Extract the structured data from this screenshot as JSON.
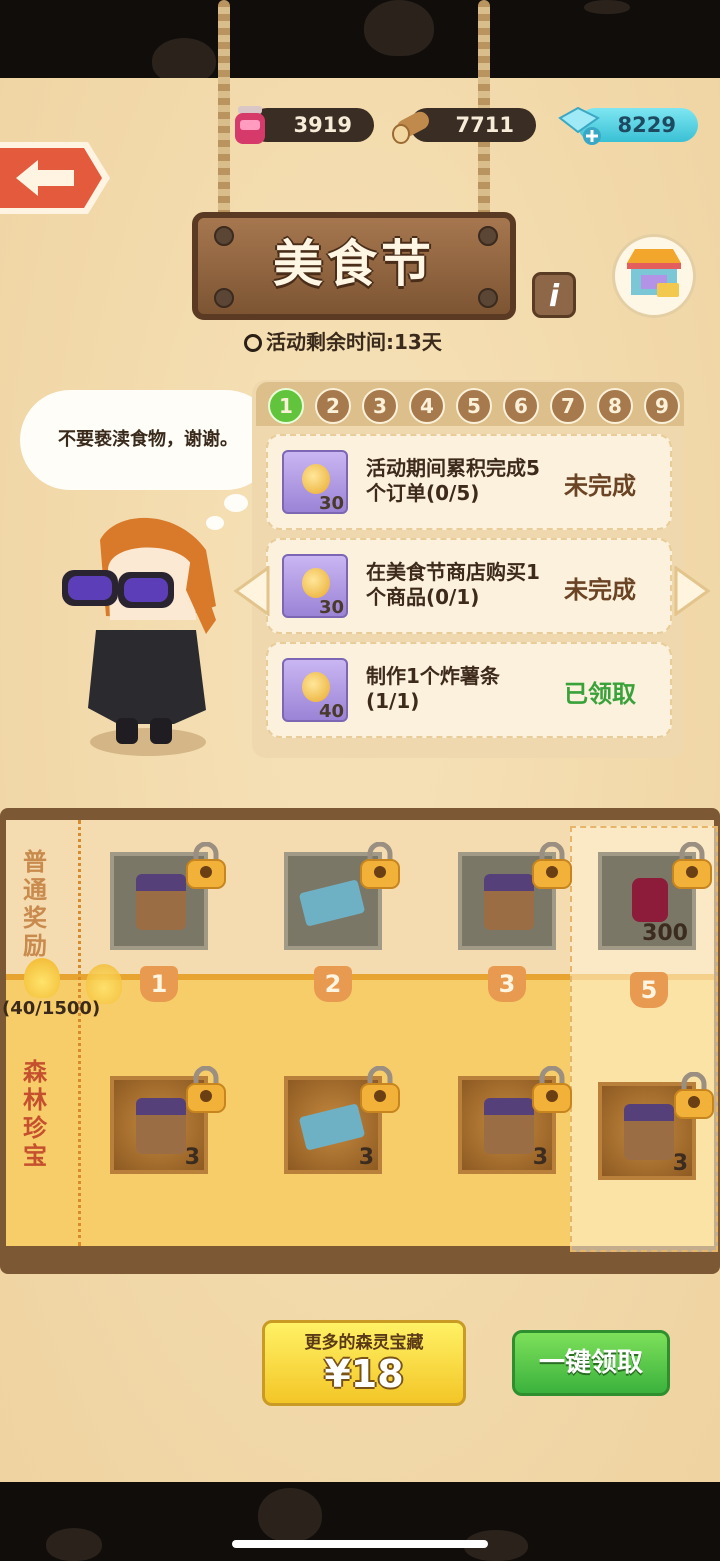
{
  "resources": {
    "jam": "3919",
    "wood": "7711",
    "gems": "8229"
  },
  "title": "美食节",
  "timer": "活动剩余时间:13天",
  "speech": "不要亵渎食物，谢谢。",
  "steps": [
    "1",
    "2",
    "3",
    "4",
    "5",
    "6",
    "7",
    "8",
    "9"
  ],
  "tasks": [
    {
      "qty": "30",
      "desc": "活动期间累积完成5个订单(0/5)",
      "status": "未完成"
    },
    {
      "qty": "30",
      "desc": "在美食节商店购买1个商品(0/1)",
      "status": "未完成"
    },
    {
      "qty": "40",
      "desc": "制作1个炸薯条(1/1)",
      "status": "已领取"
    }
  ],
  "track": {
    "free_label": "普通奖励",
    "premium_label": "森林珍宝",
    "progress": "(40/1500)",
    "milestones": [
      "1",
      "2",
      "3",
      "5"
    ],
    "free_rewards": [
      {
        "item": "cake",
        "qty": ""
      },
      {
        "item": "ticket",
        "qty": ""
      },
      {
        "item": "cake",
        "qty": ""
      },
      {
        "item": "jam-jar",
        "qty": "300"
      }
    ],
    "premium_rewards": [
      {
        "item": "cake",
        "qty": "3"
      },
      {
        "item": "ticket",
        "qty": "3"
      },
      {
        "item": "cake",
        "qty": "3"
      },
      {
        "item": "cake",
        "qty": "3"
      }
    ]
  },
  "buttons": {
    "buy_subtitle": "更多的森灵宝藏",
    "buy_price": "¥18",
    "claim_all": "一键领取"
  },
  "colors": {
    "parchment": "#f4ddb0",
    "premium_tier": "#f7cd6a",
    "claim_green": "#3bb23d",
    "active_step": "#62c43c"
  }
}
